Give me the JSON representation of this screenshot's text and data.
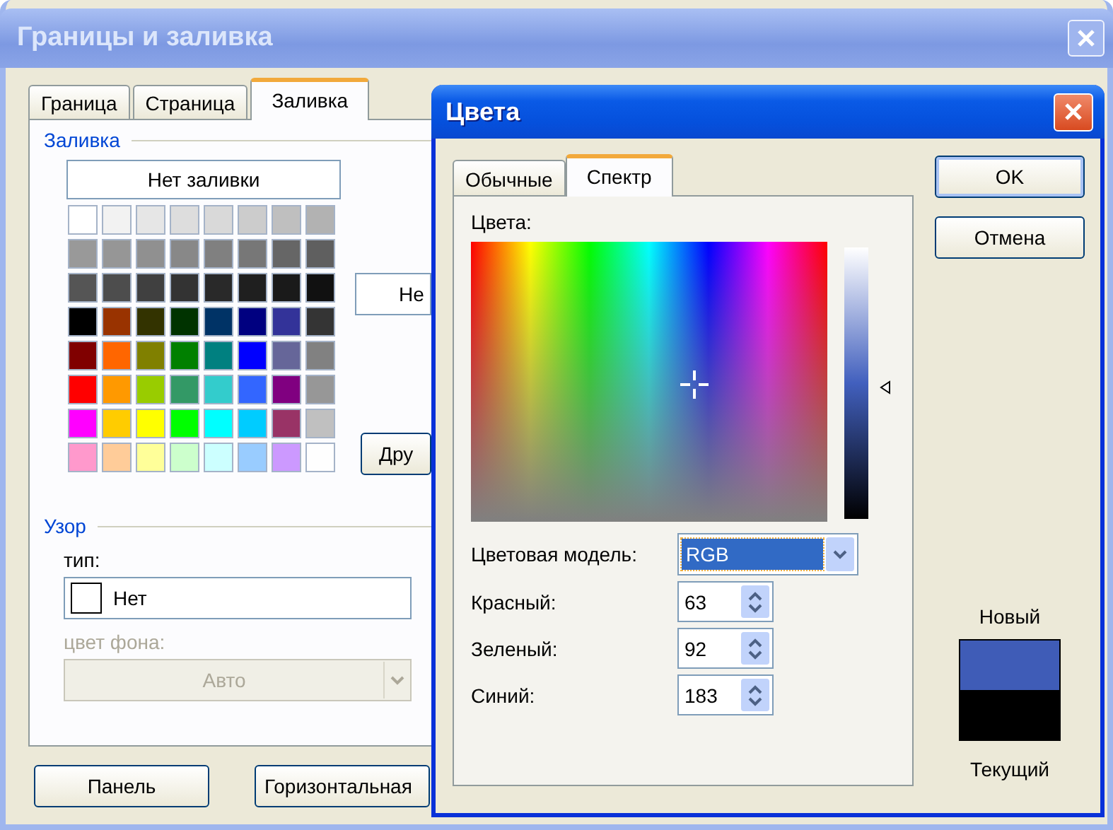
{
  "main_window": {
    "title": "Границы и заливка",
    "tabs": [
      {
        "label": "Граница",
        "selected": false
      },
      {
        "label": "Страница",
        "selected": false
      },
      {
        "label": "Заливка",
        "selected": true
      }
    ],
    "fill": {
      "legend": "Заливка",
      "no_fill_button": "Нет заливки",
      "palette": [
        {
          "color": "#ffffff"
        },
        {
          "color": "#f2f2f2"
        },
        {
          "color": "#e6e6e6"
        },
        {
          "color": "#dddddd"
        },
        {
          "color": "#d9d9d9"
        },
        {
          "color": "#cccccc"
        },
        {
          "color": "#bfbfbf"
        },
        {
          "color": "#b2b2b2"
        },
        {
          "color": "#999999"
        },
        {
          "color": "#969696"
        },
        {
          "color": "#909090"
        },
        {
          "color": "#888888"
        },
        {
          "color": "#808080"
        },
        {
          "color": "#777777"
        },
        {
          "color": "#666666"
        },
        {
          "color": "#5f5f5f"
        },
        {
          "color": "#555555"
        },
        {
          "color": "#4d4d4d"
        },
        {
          "color": "#404040"
        },
        {
          "color": "#333333"
        },
        {
          "color": "#292929"
        },
        {
          "color": "#1f1f1f"
        },
        {
          "color": "#1a1a1a"
        },
        {
          "color": "#111111"
        },
        {
          "color": "#000000"
        },
        {
          "color": "#993300"
        },
        {
          "color": "#333300"
        },
        {
          "color": "#003300"
        },
        {
          "color": "#003366"
        },
        {
          "color": "#000080"
        },
        {
          "color": "#333399"
        },
        {
          "color": "#343434"
        },
        {
          "color": "#800000"
        },
        {
          "color": "#ff6600"
        },
        {
          "color": "#808000"
        },
        {
          "color": "#008000"
        },
        {
          "color": "#008080"
        },
        {
          "color": "#0000ff"
        },
        {
          "color": "#666699"
        },
        {
          "color": "#818181"
        },
        {
          "color": "#ff0000"
        },
        {
          "color": "#ff9900"
        },
        {
          "color": "#99cc00"
        },
        {
          "color": "#339966"
        },
        {
          "color": "#33cccc"
        },
        {
          "color": "#3366ff"
        },
        {
          "color": "#800080"
        },
        {
          "color": "#979797"
        },
        {
          "color": "#ff00ff"
        },
        {
          "color": "#ffcc00"
        },
        {
          "color": "#ffff00"
        },
        {
          "color": "#00ff00"
        },
        {
          "color": "#00ffff"
        },
        {
          "color": "#00ccff"
        },
        {
          "color": "#993366"
        },
        {
          "color": "#c0c0c0"
        },
        {
          "color": "#ff99cc"
        },
        {
          "color": "#ffcc99"
        },
        {
          "color": "#ffff99"
        },
        {
          "color": "#ccffcc"
        },
        {
          "color": "#ccffff"
        },
        {
          "color": "#99ccff"
        },
        {
          "color": "#cc99ff"
        },
        {
          "color": "#fefefe"
        }
      ],
      "side_button": "Не",
      "more_button": "Дру"
    },
    "pattern": {
      "legend": "Узор",
      "type_label": "тип:",
      "type_value": "Нет",
      "background_label": "цвет фона:",
      "background_value": "Авто",
      "background_disabled": true
    },
    "buttons": [
      "Панель",
      "Горизонтальная"
    ]
  },
  "colors_dialog": {
    "title": "Цвета",
    "tabs": [
      {
        "label": "Обычные",
        "selected": false
      },
      {
        "label": "Спектр",
        "selected": true
      }
    ],
    "colors_label": "Цвета:",
    "model_label": "Цветовая модель:",
    "model_value": "RGB",
    "channels": [
      {
        "label": "Красный:",
        "value": "63"
      },
      {
        "label": "Зеленый:",
        "value": "92"
      },
      {
        "label": "Синий:",
        "value": "183"
      }
    ],
    "buttons": [
      {
        "label": "OK",
        "default": true
      },
      {
        "label": "Отмена",
        "default": false
      }
    ],
    "preview": {
      "new_label": "Новый",
      "current_label": "Текущий",
      "current": {
        "color": "#000000"
      }
    }
  }
}
